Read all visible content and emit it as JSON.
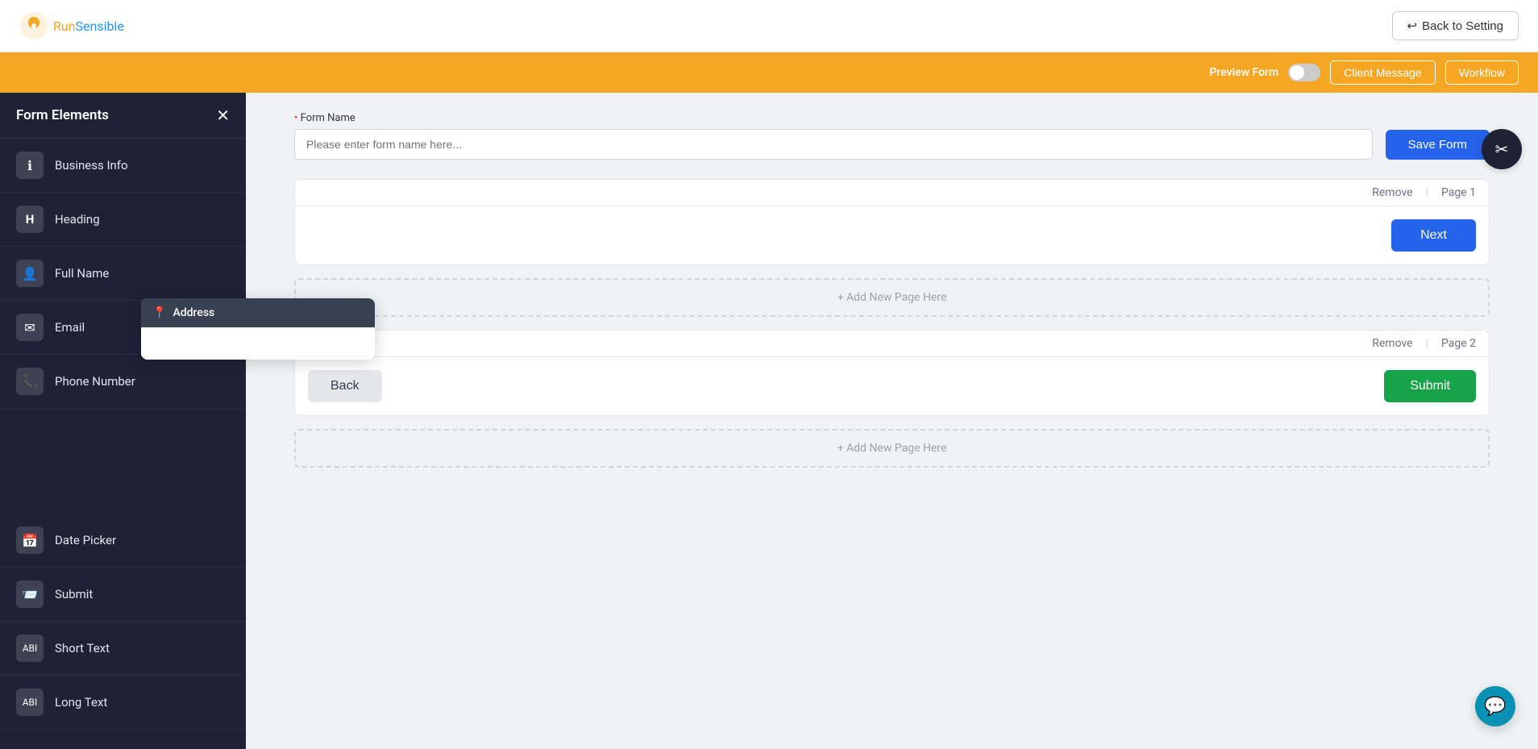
{
  "header": {
    "logo_run": "Run",
    "logo_sensible": "Sensible",
    "back_to_setting_label": "Back to Setting"
  },
  "orange_bar": {
    "preview_form_label": "Preview Form",
    "client_message_btn": "Client Message",
    "workflow_btn": "Workflow"
  },
  "sidebar": {
    "title": "Form Elements",
    "items": [
      {
        "id": "business-info",
        "label": "Business Info",
        "icon": "ℹ"
      },
      {
        "id": "heading",
        "label": "Heading",
        "icon": "H"
      },
      {
        "id": "full-name",
        "label": "Full Name",
        "icon": "👤"
      },
      {
        "id": "email",
        "label": "Email",
        "icon": "✉"
      },
      {
        "id": "phone-number",
        "label": "Phone Number",
        "icon": "📞"
      },
      {
        "id": "date-picker",
        "label": "Date Picker",
        "icon": "📅"
      },
      {
        "id": "submit",
        "label": "Submit",
        "icon": "📨"
      },
      {
        "id": "short-text",
        "label": "Short Text",
        "icon": "🔤"
      },
      {
        "id": "long-text",
        "label": "Long Text",
        "icon": "📄"
      }
    ]
  },
  "address_tooltip": {
    "header_label": "Address",
    "header_icon": "📍"
  },
  "form_name": {
    "label": "Form Name",
    "placeholder": "Please enter form name here...",
    "save_btn": "Save Form"
  },
  "page1": {
    "remove_label": "Remove",
    "page_label": "Page 1",
    "next_btn": "Next"
  },
  "add_page_1": {
    "label": "+ Add New Page Here"
  },
  "page2": {
    "remove_label": "Remove",
    "page_label": "Page 2",
    "back_btn": "Back",
    "submit_btn": "Submit"
  },
  "add_page_2": {
    "label": "+ Add New Page Here"
  },
  "chat_icon": "💬",
  "avatar_icon": "✂"
}
